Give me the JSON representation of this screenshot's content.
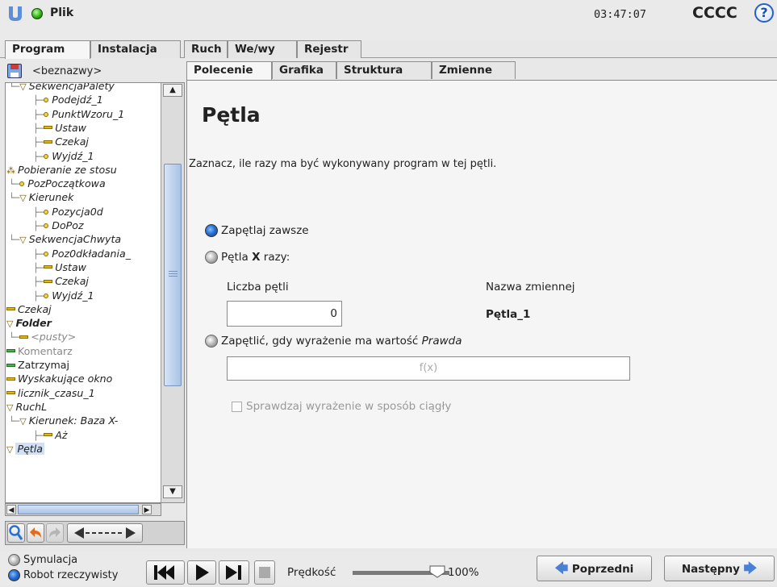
{
  "header": {
    "logo": "UR",
    "status_icon": "green-status-dot-icon",
    "file_label": "Plik",
    "time": "03:47:07",
    "robot_name": "CCCC",
    "help_label": "?"
  },
  "main_tabs": [
    "Program",
    "Instalacja",
    "Ruch",
    "We/wy",
    "Rejestr"
  ],
  "program": {
    "name": "<beznazwy>"
  },
  "sub_tabs": [
    "Polecenie",
    "Grafika",
    "Struktura",
    "Zmienne"
  ],
  "tree": [
    {
      "label": "SekwencjaPalety",
      "kind": "folder",
      "indent": 1
    },
    {
      "label": "Podejdź_1",
      "kind": "waypoint",
      "indent": 2
    },
    {
      "label": "PunktWzoru_1",
      "kind": "waypoint",
      "indent": 2
    },
    {
      "label": "Ustaw",
      "kind": "action",
      "indent": 2
    },
    {
      "label": "Czekaj",
      "kind": "action",
      "indent": 2
    },
    {
      "label": "Wyjdź_1",
      "kind": "waypoint",
      "indent": 2
    },
    {
      "label": "Pobieranie ze stosu",
      "kind": "stack",
      "indent": 0
    },
    {
      "label": "PozPoczątkowa",
      "kind": "waypoint",
      "indent": 1
    },
    {
      "label": "Kierunek",
      "kind": "folder",
      "indent": 1
    },
    {
      "label": "Pozycja0d",
      "kind": "waypoint",
      "indent": 2
    },
    {
      "label": "DoPoz",
      "kind": "waypoint",
      "indent": 2
    },
    {
      "label": "SekwencjaChwyta",
      "kind": "folder",
      "indent": 1
    },
    {
      "label": "Poz0dkładania_",
      "kind": "waypoint",
      "indent": 2
    },
    {
      "label": "Ustaw",
      "kind": "action",
      "indent": 2
    },
    {
      "label": "Czekaj",
      "kind": "action",
      "indent": 2
    },
    {
      "label": "Wyjdź_1",
      "kind": "waypoint",
      "indent": 2
    },
    {
      "label": "Czekaj",
      "kind": "action",
      "indent": 0
    },
    {
      "label": "Folder",
      "kind": "folder-bold",
      "indent": 0
    },
    {
      "label": "<pusty>",
      "kind": "empty",
      "indent": 1
    },
    {
      "label": "Komentarz",
      "kind": "comment",
      "indent": 0
    },
    {
      "label": "Zatrzymaj",
      "kind": "plain",
      "indent": 0
    },
    {
      "label": "Wyskakujące okno",
      "kind": "action",
      "indent": 0
    },
    {
      "label": "licznik_czasu_1",
      "kind": "action",
      "indent": 0
    },
    {
      "label": "RuchL",
      "kind": "folder",
      "indent": 0
    },
    {
      "label": "Kierunek: Baza X-",
      "kind": "folder",
      "indent": 1
    },
    {
      "label": "Aż",
      "kind": "action",
      "indent": 2
    },
    {
      "label": "Pętla",
      "kind": "folder-selected",
      "indent": 0
    }
  ],
  "command": {
    "title": "Pętla",
    "description": "Zaznacz, ile razy ma być wykonywany program w tej pętli.",
    "option_always": "Zapętlaj zawsze",
    "option_x_prefix": "Pętla ",
    "option_x_bold": "X",
    "option_x_suffix": " razy:",
    "loop_count_label": "Liczba pętli",
    "loop_count_value": "0",
    "variable_name_label": "Nazwa zmiennej",
    "variable_name_value": "Pętla_1",
    "option_expr_prefix": "Zapętlić, gdy wyrażenie ma wartość ",
    "option_expr_italic": "Prawda",
    "expression_placeholder": "f(x)",
    "continuous_check_label": "Sprawdzaj wyrażenie w sposób ciągły"
  },
  "footer": {
    "simulation_label": "Symulacja",
    "real_robot_label": "Robot rzeczywisty",
    "speed_label": "Prędkość",
    "speed_value": "100%",
    "speed_fraction": 1.0,
    "prev_label": "Poprzedni",
    "next_label": "Następny"
  },
  "colors": {
    "accent_blue": "#2a6fd6",
    "waypoint_yellow": "#f4d24a",
    "action_yellow": "#e8b800",
    "arrow_blue": "#4a7fd6"
  }
}
